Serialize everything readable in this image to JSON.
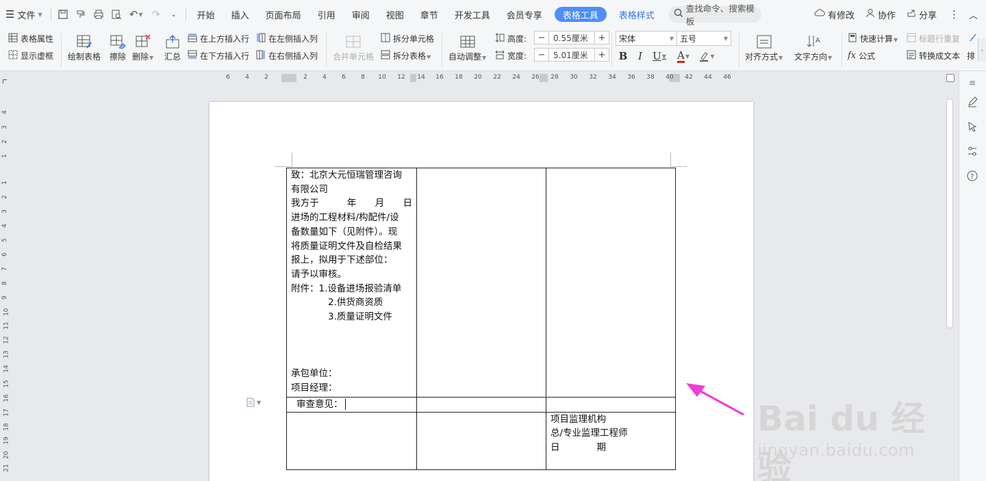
{
  "menubar": {
    "file_label": "文件",
    "tabs": [
      "开始",
      "插入",
      "页面布局",
      "引用",
      "审阅",
      "视图",
      "章节",
      "开发工具",
      "会员专享"
    ],
    "active_tab": "表格工具",
    "secondary_tab": "表格样式",
    "search_placeholder": "查找命令、搜索模板",
    "unsaved_label": "有修改",
    "collab_label": "协作",
    "share_label": "分享"
  },
  "ribbon": {
    "table_props": "表格属性",
    "show_gridlines": "显示虚框",
    "draw_table": "绘制表格",
    "eraser": "擦除",
    "delete": "删除",
    "summary": "汇总",
    "insert_row_above": "在上方插入行",
    "insert_row_below": "在下方插入行",
    "insert_col_left": "在左侧插入列",
    "insert_col_right": "在右侧插入列",
    "merge_cells": "合并单元格",
    "split_cells": "拆分单元格",
    "split_table": "拆分表格",
    "auto_fit": "自动调整",
    "height_label": "高度:",
    "height_value": "0.55厘米",
    "width_label": "宽度:",
    "width_value": "5.01厘米",
    "font_name": "宋体",
    "font_size": "五号",
    "align": "对齐方式",
    "text_direction": "文字方向",
    "quick_calc": "快速计算",
    "repeat_title_row": "标题行重复",
    "formula": "公式",
    "to_text": "转换成文本",
    "sort_partial": "排"
  },
  "ruler": {
    "h_numbers": [
      "6",
      "4",
      "2",
      "2",
      "4",
      "6",
      "8",
      "10",
      "12",
      "14",
      "16",
      "18",
      "20",
      "22",
      "24",
      "26",
      "28",
      "30",
      "32",
      "34",
      "36",
      "38",
      "40",
      "42",
      "44",
      "46"
    ],
    "v_numbers": [
      "4",
      "3",
      "2",
      "1",
      "1",
      "2",
      "3",
      "4",
      "5",
      "6",
      "7",
      "8",
      "9",
      "10",
      "11",
      "12",
      "13",
      "14",
      "15",
      "16",
      "17",
      "18",
      "19",
      "20",
      "21"
    ]
  },
  "document": {
    "cell_a_lines": [
      "致：北京大元恒瑞管理咨询",
      "有限公司",
      "我方于　　　年　　月　　日",
      "进场的工程材料/构配件/设",
      "备数量如下（见附件）。现",
      "将质量证明文件及自检结果",
      "报上，拟用于下述部位：",
      "请予以审核。",
      "  附件：1.设备进场报验清单",
      "　　　　2.供货商资质",
      "　　　　3.质量证明文件",
      "",
      "",
      "",
      "承包单位：",
      "项目经理："
    ],
    "review_label": "审查意见：",
    "supervisor_lines": [
      "项目监理机构",
      "总/专业监理工程师",
      "日　　　　期"
    ]
  },
  "watermark": {
    "brand": "Bai du 经验",
    "url": "jingyan.baidu.com"
  },
  "colors": {
    "accent": "#4e8ef7",
    "arrow": "#f03cd8"
  }
}
